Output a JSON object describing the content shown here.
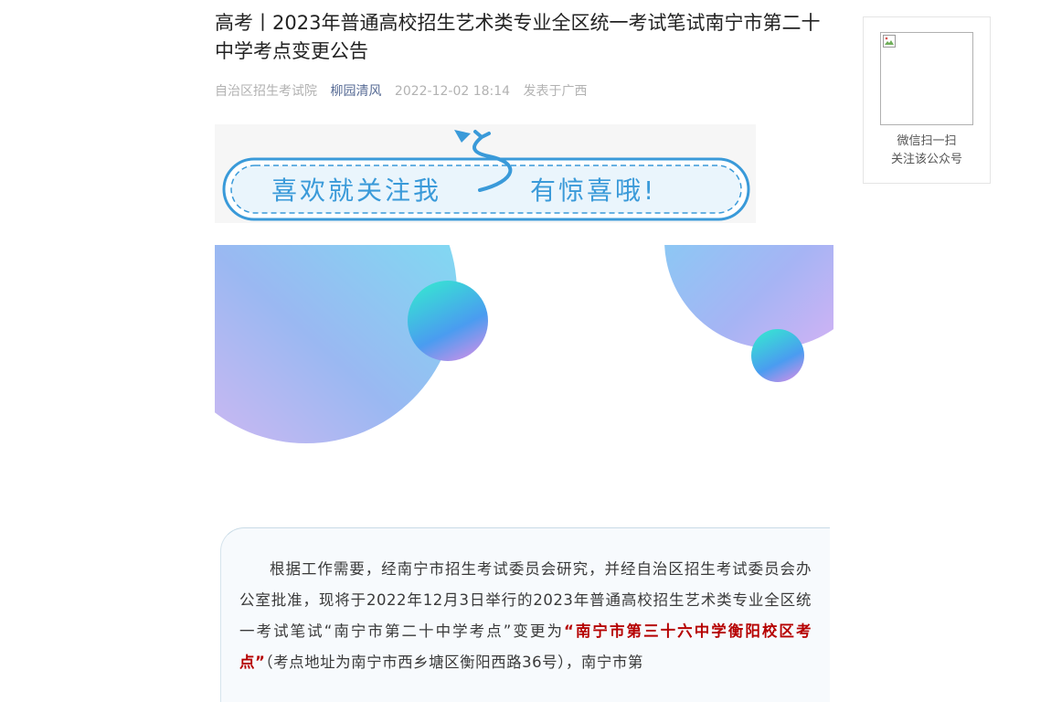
{
  "article": {
    "title": "高考丨2023年普通高校招生艺术类专业全区统一考试笔试南宁市第二十中学考点变更公告",
    "source": "自治区招生考试院",
    "author": "柳园清风",
    "datetime": "2022-12-02 18:14",
    "location": "发表于广西"
  },
  "banner": {
    "text_left": "喜欢就关注我",
    "text_right": "有惊喜哦!"
  },
  "body": {
    "part1": "根据工作需要，经南宁市招生考试委员会研究，并经自治区招生考试委员会办公室批准，现将于2022年12月3日举行的2023年普通高校招生艺术类专业全区统一考试笔试“南宁市第二十中学考点”变更为",
    "highlight": "“南宁市第三十六中学衡阳校区考点”",
    "part2": "（考点地址为南宁市西乡塘区衡阳西路36号），南宁市第"
  },
  "qr": {
    "line1": "微信扫一扫",
    "line2": "关注该公众号"
  },
  "colors": {
    "author_link": "#576b95",
    "highlight": "#b60000",
    "banner_blue": "#3a9ad9"
  }
}
